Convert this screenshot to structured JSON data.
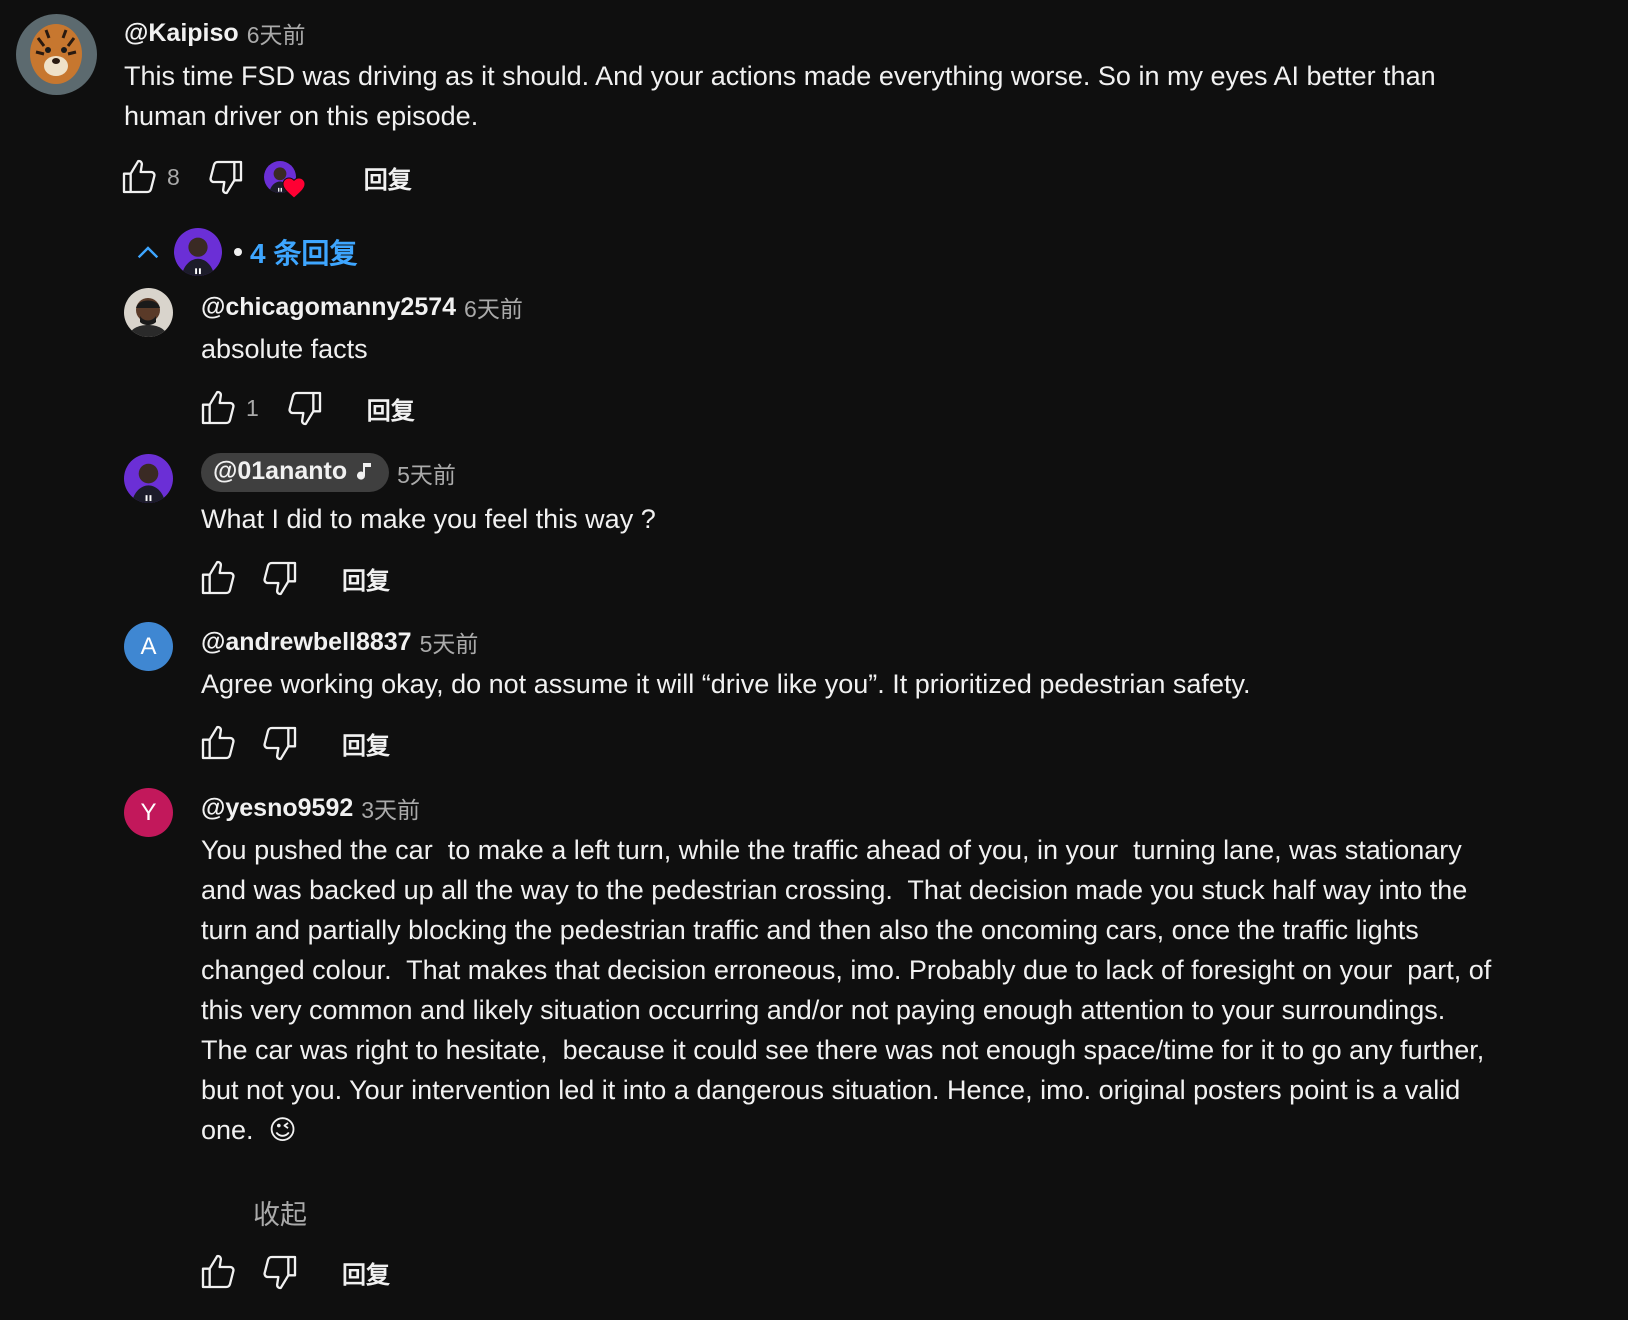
{
  "top_comment": {
    "author": "@Kaipiso",
    "time": "6天前",
    "text": "This time FSD was driving as it should. And your actions made everything worse. So in my eyes AI better than\nhuman driver on this episode.",
    "likes": "8",
    "reply_label": "回复"
  },
  "replies_toggle": {
    "label": "4 条回复"
  },
  "replies": [
    {
      "author": "@chicagomanny2574",
      "time": "6天前",
      "text": "absolute facts",
      "likes": "1",
      "reply_label": "回复"
    },
    {
      "author": "@01ananto",
      "time": "5天前",
      "text": "What I did to make you feel this way ?",
      "reply_label": "回复"
    },
    {
      "author": "@andrewbell8837",
      "time": "5天前",
      "avatar_letter": "A",
      "avatar_color": "#3f87d2",
      "text": "Agree working okay, do not assume it will “drive like you”. It prioritized pedestrian safety.",
      "reply_label": "回复"
    },
    {
      "author": "@yesno9592",
      "time": "3天前",
      "avatar_letter": "Y",
      "avatar_color": "#c2185b",
      "text": "You pushed the car  to make a left turn, while the traffic ahead of you, in your  turning lane, was stationary\nand was backed up all the way to the pedestrian crossing.  That decision made you stuck half way into the\nturn and partially blocking the pedestrian traffic and then also the oncoming cars, once the traffic lights\nchanged colour.  That makes that decision erroneous, imo. Probably due to lack of foresight on your  part, of\nthis very common and likely situation occurring and/or not paying enough attention to your surroundings.\nThe car was right to hesitate,  because it could see there was not enough space/time for it to go any further,\nbut not you. Your intervention led it into a dangerous situation. Hence, imo. original posters point is a valid\none.  😉",
      "show_less": "收起",
      "reply_label": "回复"
    }
  ],
  "icons": {
    "like": "thumbs-up-icon",
    "dislike": "thumbs-down-icon",
    "collapse": "chevron-up-icon",
    "music": "music-note-icon",
    "heart": "heart-icon"
  },
  "colors": {
    "background": "#0f0f0f",
    "link": "#3ea6ff",
    "heart": "#ff0033"
  }
}
